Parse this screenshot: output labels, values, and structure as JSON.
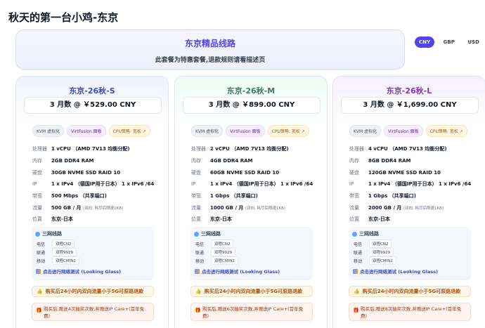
{
  "page": {
    "title": "秋天的第一台小鸡-东京"
  },
  "banner": {
    "title": "东京精品线路",
    "subtitle": "此套餐为特惠套餐,退款规则请看描述页"
  },
  "currency": {
    "options": [
      "CNY",
      "GBP",
      "USD"
    ],
    "selected": "CNY"
  },
  "spec_labels": [
    "处理器",
    "内存",
    "硬盘",
    "IP",
    "带宽",
    "流量",
    "位置"
  ],
  "tags": {
    "kvm": "KVM 虚拟化",
    "virtfusion": "VirtFusion 面板",
    "cpu": "CPU策略: 宽松 ↗"
  },
  "network": {
    "title": "三网线路",
    "rows": [
      {
        "isp": "电信",
        "line": "双程CN2"
      },
      {
        "isp": "联通",
        "line": "双程9929"
      },
      {
        "isp": "移动",
        "line": "双程CMIN2"
      }
    ],
    "lg_link": "点击进行网络测试 (Looking Glass)"
  },
  "refund_note": "购买后24小时内双向流量小于5G可原路退款",
  "plans": [
    {
      "name": "东京-26秋-S",
      "price": "3 月数 @ ￥529.00 CNY",
      "cpu": "1 vCPU （AMD 7V13 均衡分配)",
      "ram": "2GB DDR4 RAM",
      "disk": "30GB NVME SSD RAID 10",
      "ip": "1 x IPv4 （德国IP用于日本） 1 x IPv6 /64",
      "bandwidth": "500 Mbps （共享端口)",
      "traffic": "500 GB / 月",
      "traffic_note": "(双向, 耗尽后限速1KB)",
      "location": "东京-日本",
      "gift": "购买后,赠送4次抽奖次数,并赠送IP Care+(首年免费)"
    },
    {
      "name": "东京-26秋-M",
      "price": "3 月数 @ ￥899.00 CNY",
      "cpu": "2 vCPU （AMD 7V13 均衡分配)",
      "ram": "4GB DDR4 RAM",
      "disk": "60GB NVME SSD RAID 10",
      "ip": "1 x IPv4 （德国IP用于日本） 1 x IPv6 /64",
      "bandwidth": "1 Gbps （共享端口)",
      "traffic": "1000 GB / 月",
      "traffic_note": "(双向, 耗尽后限速1KB)",
      "location": "东京-日本",
      "gift": "购买后,赠送6次抽奖次数,并赠送IP Care+(首年免费)"
    },
    {
      "name": "东京-26秋-L",
      "price": "3 月数 @ ￥1,699.00 CNY",
      "cpu": "4 vCPU （AMD 7V13 均衡分配)",
      "ram": "8GB DDR4 RAM",
      "disk": "120GB NVME SSD RAID 10",
      "ip": "1 x IPv4 （德国IP用于日本） 1 x IPv6 /64",
      "bandwidth": "1 Gbps （共享端口)",
      "traffic": "2000 GB / 月",
      "traffic_note": "(双向, 耗尽后限速1KB)",
      "location": "东京-日本",
      "gift": "购买后,赠送8次抽奖次数,并赠送IP Care+(首年免费)"
    }
  ]
}
